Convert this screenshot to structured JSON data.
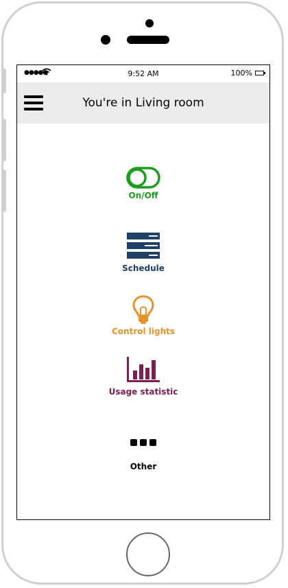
{
  "status_bar": {
    "signal": "●●●●●",
    "time": "9:52 AM",
    "battery": "100%"
  },
  "header": {
    "title": "You're in Living room",
    "menu_icon": "hamburger-icon"
  },
  "menu": [
    {
      "label": "On/Off",
      "icon": "toggle-icon",
      "color": "#1e9c1e"
    },
    {
      "label": "Schedule",
      "icon": "schedule-list-icon",
      "color": "#1e3f66"
    },
    {
      "label": "Control lights",
      "icon": "lightbulb-icon",
      "color": "#e6922a"
    },
    {
      "label": "Usage statistic",
      "icon": "bar-chart-icon",
      "color": "#7a1f4f"
    },
    {
      "label": "Other",
      "icon": "more-dots-icon",
      "color": "#000000"
    }
  ]
}
